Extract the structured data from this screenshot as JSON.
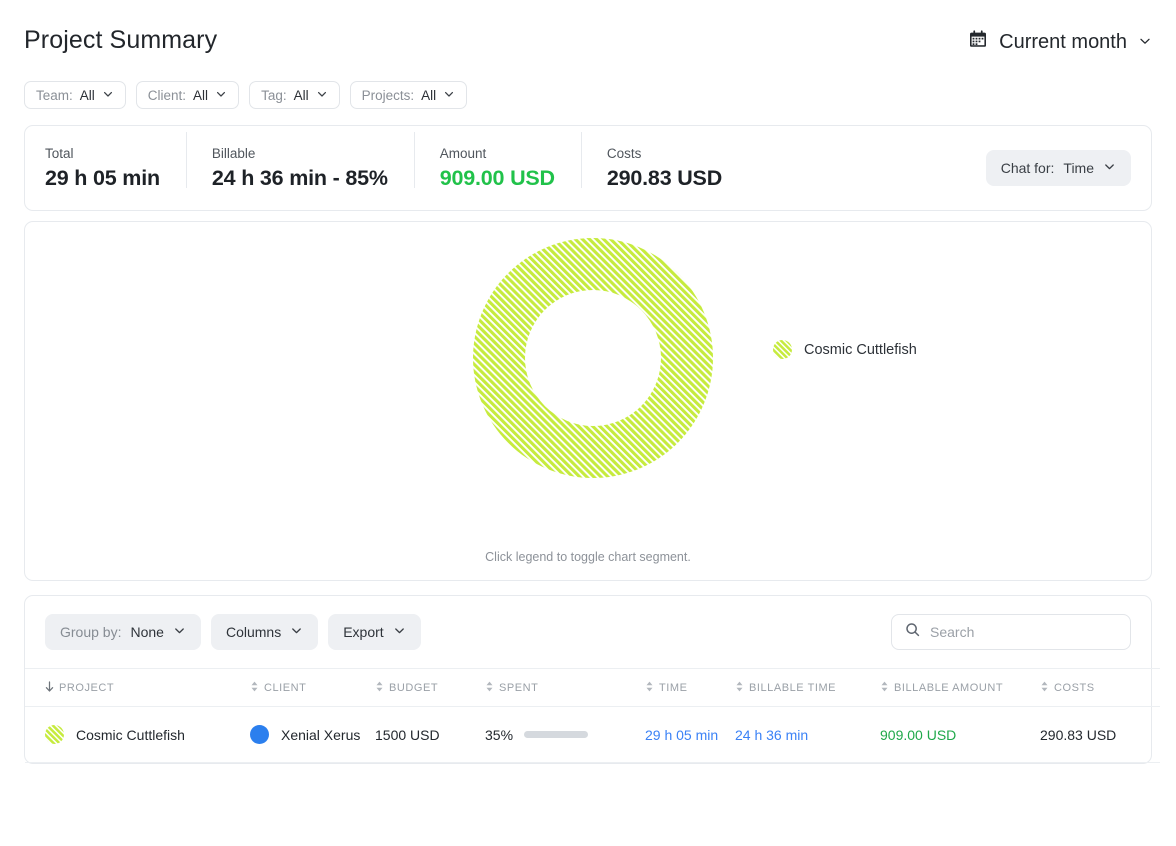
{
  "header": {
    "title": "Project Summary",
    "date_range": "Current month",
    "calendar_icon": "calendar-icon",
    "chevron_icon": "chevron-down-icon"
  },
  "filters": [
    {
      "label": "Team:",
      "value": "All"
    },
    {
      "label": "Client:",
      "value": "All"
    },
    {
      "label": "Tag:",
      "value": "All"
    },
    {
      "label": "Projects:",
      "value": "All"
    }
  ],
  "summary": {
    "stats": [
      {
        "key": "Total",
        "value": "29 h 05 min"
      },
      {
        "key": "Billable",
        "value": "24 h 36 min - 85%"
      },
      {
        "key": "Amount",
        "value": "909.00 USD",
        "color": "#21c24a"
      },
      {
        "key": "Costs",
        "value": "290.83 USD"
      }
    ],
    "chat_selector": {
      "label": "Chat for:",
      "value": "Time"
    }
  },
  "chart_data": {
    "type": "pie",
    "variant": "donut",
    "title": "",
    "categories": [
      "Cosmic Cuttlefish"
    ],
    "values": [
      100
    ],
    "value_unit": "percent",
    "colors": [
      "#c6eb3e"
    ],
    "pattern": "diagonal-hatch",
    "legend": [
      {
        "label": "Cosmic Cuttlefish",
        "color": "#c6eb3e",
        "percent": 100
      }
    ],
    "legend_position": "right",
    "hint": "Click legend to toggle chart segment."
  },
  "table": {
    "toolbar": {
      "group_by": {
        "label": "Group by:",
        "value": "None"
      },
      "columns_label": "Columns",
      "export_label": "Export",
      "search_placeholder": "Search",
      "search_value": "",
      "search_icon": "search-icon"
    },
    "columns": [
      {
        "label": "PROJECT",
        "sort": "desc",
        "align": "left"
      },
      {
        "label": "CLIENT",
        "sort": "none",
        "align": "left"
      },
      {
        "label": "BUDGET",
        "sort": "none",
        "align": "left"
      },
      {
        "label": "SPENT",
        "sort": "none",
        "align": "left"
      },
      {
        "label": "TIME",
        "sort": "none",
        "align": "left"
      },
      {
        "label": "BILLABLE TIME",
        "sort": "none",
        "align": "left"
      },
      {
        "label": "BILLABLE AMOUNT",
        "sort": "none",
        "align": "left"
      },
      {
        "label": "COSTS",
        "sort": "none",
        "align": "right"
      }
    ],
    "rows": [
      {
        "project": "Cosmic Cuttlefish",
        "project_color": "#c6eb3e",
        "client": "Xenial Xerus",
        "client_color": "#2b7fee",
        "budget": "1500 USD",
        "spent_percent": "35%",
        "spent_value": 35,
        "time": "29 h 05 min",
        "billable_time": "24 h 36 min",
        "billable_amount": "909.00 USD",
        "costs": "290.83 USD"
      }
    ]
  }
}
